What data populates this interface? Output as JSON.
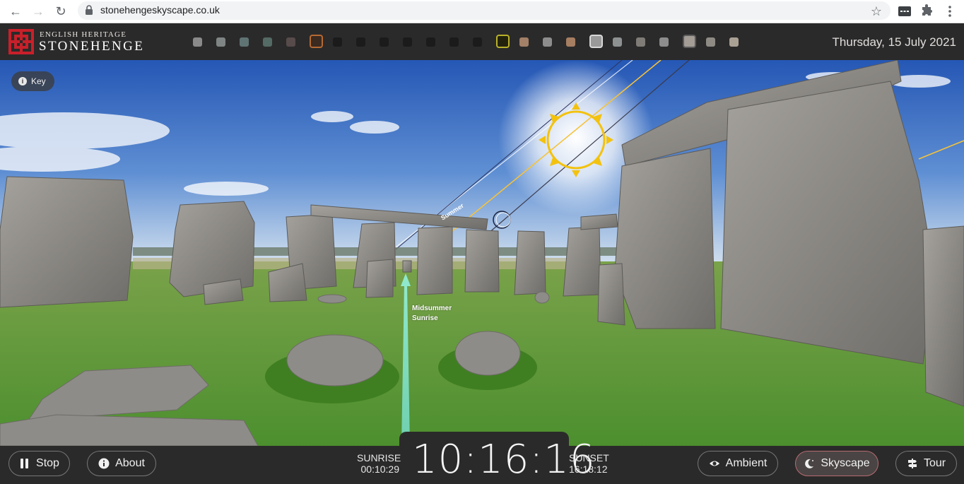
{
  "browser": {
    "url": "stonehengeskyscape.co.uk"
  },
  "header": {
    "brand_small": "ENGLISH HERITAGE",
    "brand_large": "STONEHENGE",
    "date": "Thursday, 15 July 2021",
    "swatches": [
      {
        "color": "#8a8a8a",
        "ringed": false
      },
      {
        "color": "#7f8584",
        "ringed": false
      },
      {
        "color": "#5f7373",
        "ringed": false
      },
      {
        "color": "#546a64",
        "ringed": false
      },
      {
        "color": "#574b4b",
        "ringed": false
      },
      {
        "color": "#3a2a20",
        "ringed": true,
        "ring": "#b56a33"
      },
      {
        "color": "#1b1b1b",
        "ringed": false
      },
      {
        "color": "#1b1b1b",
        "ringed": false
      },
      {
        "color": "#1b1b1b",
        "ringed": false
      },
      {
        "color": "#1b1b1b",
        "ringed": false
      },
      {
        "color": "#1b1b1b",
        "ringed": false
      },
      {
        "color": "#1b1b1b",
        "ringed": false
      },
      {
        "color": "#1b1b1b",
        "ringed": false
      },
      {
        "color": "#23230d",
        "ringed": true,
        "ring": "#b9b22a"
      },
      {
        "color": "#a38068",
        "ringed": false
      },
      {
        "color": "#8d8d8d",
        "ringed": false
      },
      {
        "color": "#a67e62",
        "ringed": false
      },
      {
        "color": "#999999",
        "ringed": true,
        "ring": "#d8d8d8"
      },
      {
        "color": "#8d9191",
        "ringed": false
      },
      {
        "color": "#7f7b76",
        "ringed": false
      },
      {
        "color": "#8d8d8d",
        "ringed": false
      },
      {
        "color": "#a39d96",
        "ringed": true,
        "ring": "#5a5a5a"
      },
      {
        "color": "#8e8a84",
        "ringed": false
      },
      {
        "color": "#aaa195",
        "ringed": false
      }
    ]
  },
  "scene": {
    "key_label": "Key",
    "sunrise_marker_line1": "Midsummer",
    "sunrise_marker_line2": "Sunrise",
    "sun_path_label": "Summer",
    "sky_top": "#2a60c2",
    "sky_horizon": "#c7d9ee",
    "grass": "#5d9b3c",
    "stone": "#8e8c88"
  },
  "footer": {
    "stop_label": "Stop",
    "about_label": "About",
    "sunrise_label": "SUNRISE",
    "sunrise_time": "00:10:29",
    "clock": "10:16:16",
    "sunset_label": "SUNSET",
    "sunset_time": "16:18:12",
    "ambient_label": "Ambient",
    "skyscape_label": "Skyscape",
    "tour_label": "Tour"
  }
}
